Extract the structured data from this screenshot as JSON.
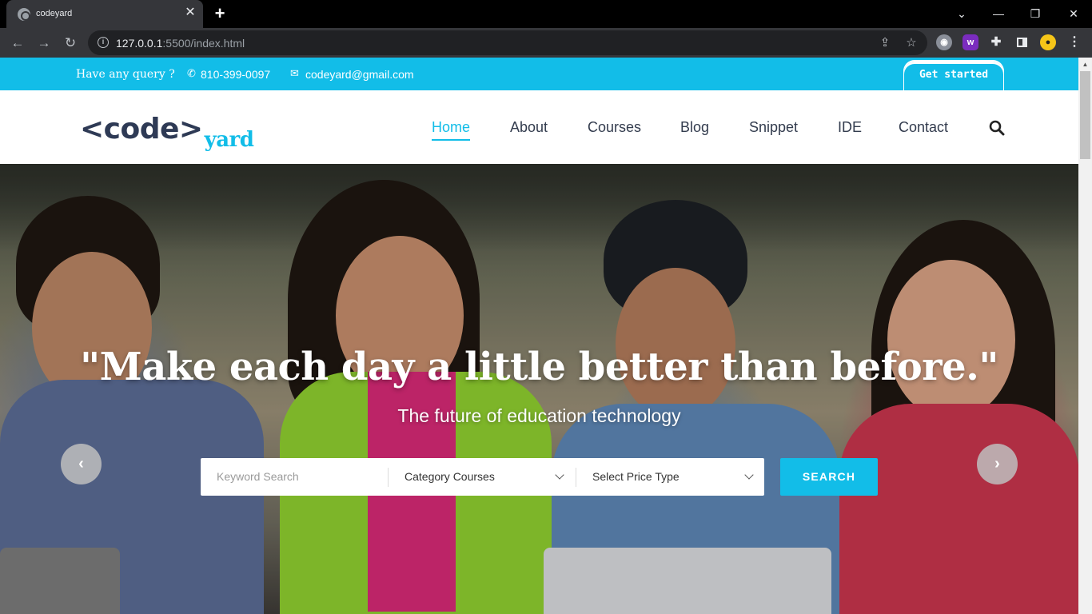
{
  "browser": {
    "tab_title": "codeyard",
    "tab_close": "✕",
    "new_tab": "+",
    "url_host": "127.0.0.1",
    "url_rest": ":5500/index.html",
    "window_buttons": [
      "⌄",
      "—",
      "❐",
      "✕"
    ]
  },
  "topbar": {
    "query_label": "Have any query ?",
    "phone": "810-399-0097",
    "email": "codeyard@gmail.com",
    "get_started": "Get started",
    "accent_color": "#12bde8"
  },
  "header": {
    "logo_main": "<code>",
    "logo_sub": "yard",
    "nav": [
      {
        "label": "Home",
        "active": true
      },
      {
        "label": "About"
      },
      {
        "label": "Courses"
      },
      {
        "label": "Blog"
      },
      {
        "label": "Snippet"
      },
      {
        "label": "IDE"
      },
      {
        "label": "Contact"
      }
    ]
  },
  "hero": {
    "title": "\"Make each day a little better than before.\"",
    "subtitle": "The future of education technology",
    "search": {
      "keyword_placeholder": "Keyword Search",
      "category_selected": "Category Courses",
      "price_selected": "Select Price Type",
      "button": "SEARCH"
    },
    "prev_arrow": "‹",
    "next_arrow": "›"
  }
}
